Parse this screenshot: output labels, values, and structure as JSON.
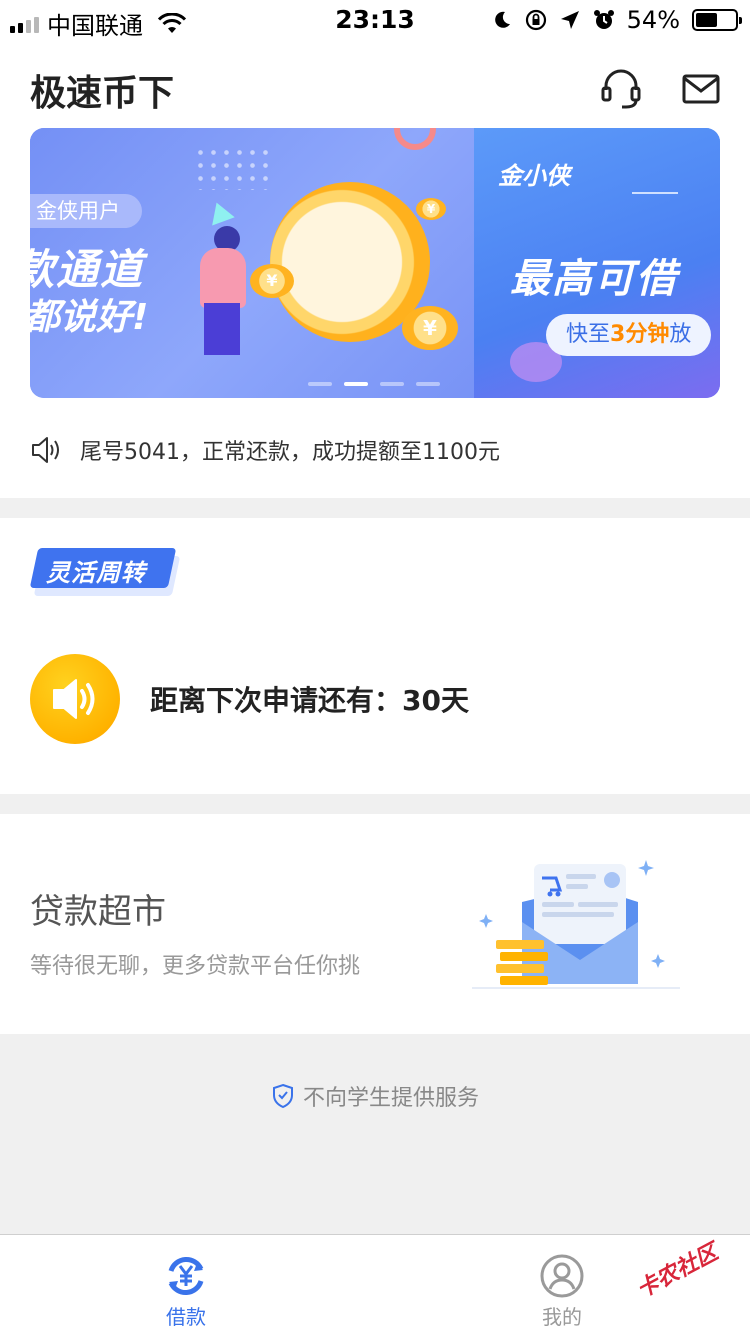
{
  "status_bar": {
    "carrier": "中国联通",
    "time": "23:13",
    "battery_percent": "54%",
    "battery_level": 0.54,
    "signal_bars": 2
  },
  "header": {
    "title": "极速币下",
    "icons": [
      "headset-icon",
      "mail-icon"
    ]
  },
  "banner": {
    "slide_a": {
      "tag": "金侠用户",
      "line1": "款通道",
      "line2": "都说好!"
    },
    "slide_b": {
      "brand": "金小侠",
      "headline": "最高可借",
      "pill_prefix": "快至",
      "pill_highlight": "3分钟",
      "pill_suffix": "放"
    },
    "slide_count": 4,
    "active_slide": 2
  },
  "notice": {
    "text": "尾号5041，正常还款，成功提额至1100元"
  },
  "flex_section": {
    "tag": "灵活周转",
    "countdown_text": "距离下次申请还有：30天"
  },
  "market": {
    "title": "贷款超市",
    "subtitle": "等待很无聊，更多贷款平台任你挑"
  },
  "disclaimer": {
    "text": "不向学生提供服务"
  },
  "tabbar": {
    "tabs": [
      {
        "label": "借款",
        "icon": "loan-yen-icon",
        "active": true
      },
      {
        "label": "我的",
        "icon": "user-icon",
        "active": false
      }
    ]
  },
  "watermark": {
    "text": "卡农社区"
  },
  "colors": {
    "accent": "#3a73ea",
    "countdown_icon": "#ffb300",
    "section_gap": "#f0f0f0"
  }
}
